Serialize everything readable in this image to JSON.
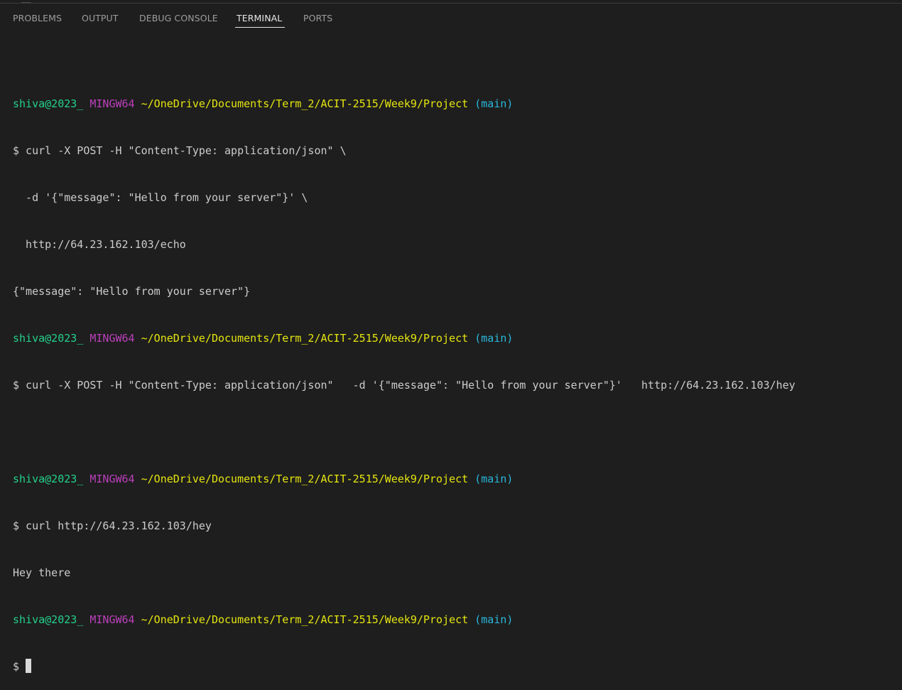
{
  "panel": {
    "tabs": [
      {
        "label": "PROBLEMS",
        "active": false
      },
      {
        "label": "OUTPUT",
        "active": false
      },
      {
        "label": "DEBUG CONSOLE",
        "active": false
      },
      {
        "label": "TERMINAL",
        "active": true
      },
      {
        "label": "PORTS",
        "active": false
      }
    ]
  },
  "terminal": {
    "prompt": {
      "user": "shiva@2023_",
      "system": "MINGW64",
      "path": "~/OneDrive/Documents/Term_2/ACIT-2515/Week9/Project",
      "branch": "(main)",
      "symbol": "$"
    },
    "lines": {
      "cmd1_l1": "$ curl -X POST -H \"Content-Type: application/json\" \\",
      "cmd1_l2": "  -d '{\"message\": \"Hello from your server\"}' \\",
      "cmd1_l3": "  http://64.23.162.103/echo",
      "out1": "{\"message\": \"Hello from your server\"}",
      "cmd2": "$ curl -X POST -H \"Content-Type: application/json\"   -d '{\"message\": \"Hello from your server\"}'   http://64.23.162.103/hey",
      "cmd3": "$ curl http://64.23.162.103/hey",
      "out3": "Hey there"
    }
  },
  "colors": {
    "background": "#1e1e1e",
    "user": "#23d18b",
    "mingw": "#bc3fbc",
    "path": "#e5e510",
    "branch": "#29b8db",
    "text": "#cccccc"
  }
}
